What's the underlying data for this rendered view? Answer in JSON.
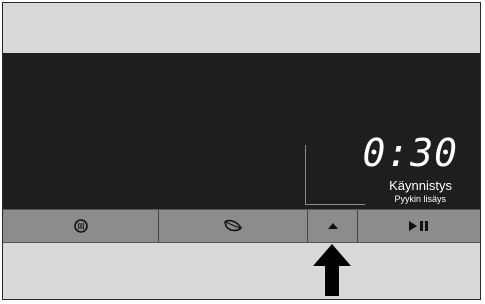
{
  "display": {
    "time": "0:30",
    "status_primary": "Käynnistys",
    "status_secondary": "Pyykin lisäys"
  },
  "buttons": [
    {
      "icon": "steam-icon"
    },
    {
      "icon": "leaf-icon"
    },
    {
      "icon": "arrow-up-small-icon"
    },
    {
      "icon": "play-pause-icon"
    }
  ],
  "colors": {
    "panel": "#d9d9d9",
    "display": "#1e1e1e",
    "button_bar": "#8c8c8c",
    "text_display": "#ffffff"
  }
}
